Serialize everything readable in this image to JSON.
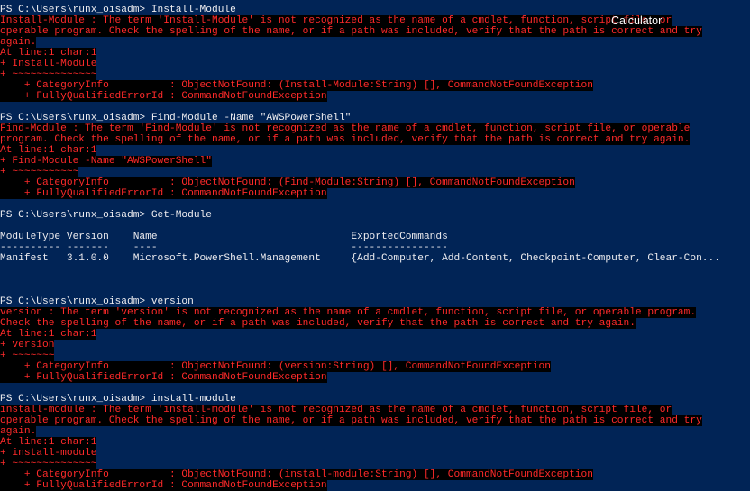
{
  "overlay": {
    "calculator_label": "Calculator"
  },
  "blocks": [
    {
      "prompt": "PS C:\\Users\\runx_oisadm> Install-Module",
      "error": [
        "Install-Module : The term 'Install-Module' is not recognized as the name of a cmdlet, function, script file, or",
        "operable program. Check the spelling of the name, or if a path was included, verify that the path is correct and try",
        "again.",
        "At line:1 char:1",
        "+ Install-Module",
        "+ ~~~~~~~~~~~~~~",
        "    + CategoryInfo          : ObjectNotFound: (Install-Module:String) [], CommandNotFoundException",
        "    + FullyQualifiedErrorId : CommandNotFoundException"
      ]
    },
    {
      "prompt": "PS C:\\Users\\runx_oisadm> Find-Module -Name \"AWSPowerShell\"",
      "error": [
        "Find-Module : The term 'Find-Module' is not recognized as the name of a cmdlet, function, script file, or operable",
        "program. Check the spelling of the name, or if a path was included, verify that the path is correct and try again.",
        "At line:1 char:1",
        "+ Find-Module -Name \"AWSPowerShell\"",
        "+ ~~~~~~~~~~~",
        "    + CategoryInfo          : ObjectNotFound: (Find-Module:String) [], CommandNotFoundException",
        "    + FullyQualifiedErrorId : CommandNotFoundException"
      ]
    },
    {
      "prompt": "PS C:\\Users\\runx_oisadm> Get-Module",
      "table": {
        "header": "ModuleType Version    Name                                ExportedCommands",
        "divider": "---------- -------    ----                                ----------------",
        "rows": [
          "Manifest   3.1.0.0    Microsoft.PowerShell.Management     {Add-Computer, Add-Content, Checkpoint-Computer, Clear-Con..."
        ]
      }
    },
    {
      "prompt": "PS C:\\Users\\runx_oisadm> version",
      "error": [
        "version : The term 'version' is not recognized as the name of a cmdlet, function, script file, or operable program.",
        "Check the spelling of the name, or if a path was included, verify that the path is correct and try again.",
        "At line:1 char:1",
        "+ version",
        "+ ~~~~~~~",
        "    + CategoryInfo          : ObjectNotFound: (version:String) [], CommandNotFoundException",
        "    + FullyQualifiedErrorId : CommandNotFoundException"
      ]
    },
    {
      "prompt": "PS C:\\Users\\runx_oisadm> install-module",
      "error": [
        "install-module : The term 'install-module' is not recognized as the name of a cmdlet, function, script file, or",
        "operable program. Check the spelling of the name, or if a path was included, verify that the path is correct and try",
        "again.",
        "At line:1 char:1",
        "+ install-module",
        "+ ~~~~~~~~~~~~~~",
        "    + CategoryInfo          : ObjectNotFound: (install-module:String) [], CommandNotFoundException",
        "    + FullyQualifiedErrorId : CommandNotFoundException"
      ]
    }
  ]
}
